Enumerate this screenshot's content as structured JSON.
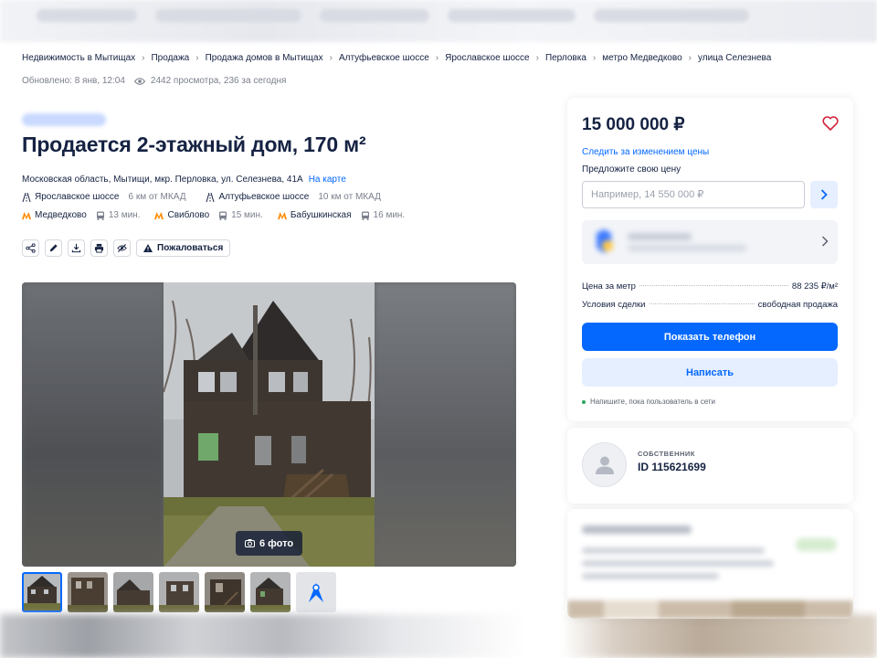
{
  "breadcrumbs": [
    "Недвижимость в Мытищах",
    "Продажа",
    "Продажа домов в Мытищах",
    "Алтуфьевское шоссе",
    "Ярославское шоссе",
    "Перловка",
    "метро Медведково",
    "улица Селезнева"
  ],
  "updated": "Обновлено: 8 янв, 12:04",
  "views": "2442 просмотра, 236 за сегодня",
  "title": "Продается 2-этажный дом, 170 м²",
  "address": "Московская область, Мытищи, мкр. Перловка, ул. Селезнева, 41А",
  "map_link": "На карте",
  "highways": [
    {
      "name": "Ярославское шоссе",
      "distance": "6 км от МКАД"
    },
    {
      "name": "Алтуфьевское шоссе",
      "distance": "10 км от МКАД"
    }
  ],
  "metro": [
    {
      "name": "Медведково",
      "time": "13 мин."
    },
    {
      "name": "Свиблово",
      "time": "15 мин."
    },
    {
      "name": "Бабушкинская",
      "time": "16 мин."
    }
  ],
  "actions": {
    "complain_label": "Пожаловаться",
    "icons": [
      "share-icon",
      "edit-icon",
      "download-icon",
      "print-icon",
      "hide-icon"
    ]
  },
  "gallery": {
    "photo_count": "6 фото",
    "thumbnail_count": 6
  },
  "sidebar": {
    "price": "15 000 000 ₽",
    "track_price": "Следить за изменением цены",
    "offer_label": "Предложите свою цену",
    "offer_placeholder": "Например, 14 550 000 ₽",
    "price_per_meter_label": "Цена за метр",
    "price_per_meter_value": "88 235 ₽/м²",
    "deal_terms_label": "Условия сделки",
    "deal_terms_value": "свободная продажа",
    "show_phone": "Показать телефон",
    "write": "Написать",
    "online_note": "Напишите, пока пользователь в сети"
  },
  "owner": {
    "role": "СОБСТВЕННИК",
    "id": "ID 115621699"
  },
  "colors": {
    "accent": "#0468ff",
    "text": "#152242",
    "muted": "#7a7f8c",
    "metro": "#ff8c00",
    "heart": "#d3203a",
    "online": "#26a65b"
  }
}
